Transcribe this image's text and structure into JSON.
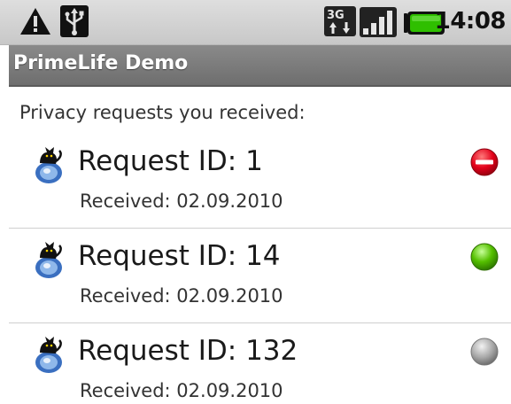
{
  "status_bar": {
    "icons": [
      "warning-icon",
      "usb-icon",
      "3g-icon",
      "signal-icon",
      "battery-icon"
    ],
    "time": "14:08",
    "battery_color": "#2fbf00"
  },
  "app": {
    "title": "PrimeLife Demo"
  },
  "main": {
    "subtitle": "Privacy requests you received:",
    "requests": [
      {
        "title": "Request ID: 1",
        "received": "Received: 02.09.2010",
        "status_icon": "denied-red-icon",
        "status_color": "#e2001a"
      },
      {
        "title": "Request ID: 14",
        "received": "Received: 02.09.2010",
        "status_icon": "accepted-green-icon",
        "status_color": "#55c000"
      },
      {
        "title": "Request ID: 132",
        "received": "Received: 02.09.2010",
        "status_icon": "pending-grey-icon",
        "status_color": "#a8a8a8"
      }
    ]
  }
}
